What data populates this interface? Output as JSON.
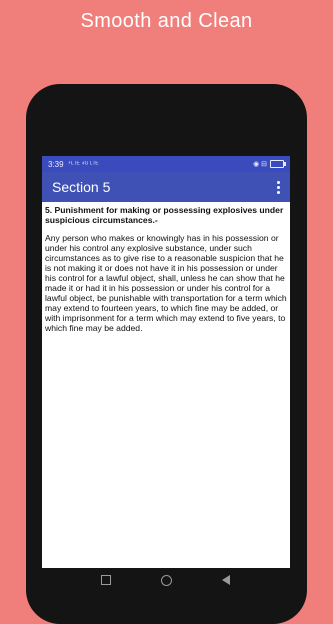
{
  "promo": {
    "headline": "Smooth and Clean"
  },
  "status_bar": {
    "time": "3:39",
    "signal_text": "⁺ᴸᵀᴱ ⁴ᴳ ᴸᵀᴱ",
    "right_text": "◉ ⊟"
  },
  "app_bar": {
    "title": "Section 5",
    "menu_icon": "more-vert-icon"
  },
  "content": {
    "heading": "5. Punishment for making or possessing explosives under suspicious circumstances.-",
    "body": "Any person who makes or knowingly has in his possession or under his control any explosive substance, under such circumstances as to give rise to a reasonable suspicion that he is not making it or does not have it in his possession or under his control for a lawful object, shall, unless he can show that he made it or had it in his possession or under his control for a lawful object, be punishable with transportation for a term which may extend to fourteen years, to which fine may be added, or with imprisonment for a term which may extend to five years, to which fine may be added."
  },
  "nav_bar": {
    "icons": [
      "recent-apps-icon",
      "home-icon",
      "back-icon"
    ]
  },
  "colors": {
    "background": "#f07f7c",
    "primary": "#3f51b5",
    "status_bar": "#3a4bbd"
  }
}
